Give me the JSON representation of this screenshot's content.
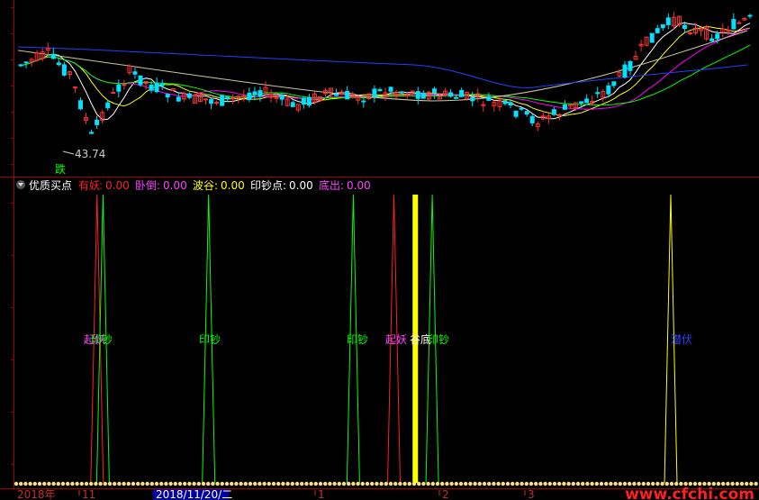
{
  "colors": {
    "background": "#000000",
    "border": "#a00000",
    "candle_up": "#ff3030",
    "candle_down": "#00e0ff",
    "ma5": "#ffffff",
    "ma10": "#ffff00",
    "ma20": "#ff00ff",
    "ma30": "#00ff00",
    "ma60": "#c8c8a0",
    "ma120": "#2040ff",
    "signal_red": "#ff2020",
    "signal_green": "#00ff00",
    "signal_yellow": "#ffff00",
    "signal_magenta": "#ff40ff",
    "signal_blue": "#3040ff",
    "url_red": "#ff2020"
  },
  "chart_data": [
    {
      "type": "candlestick",
      "panel": "price",
      "low_marker": {
        "value": "43.74",
        "label": "跌"
      },
      "series_shown": [
        "candles",
        "MA5",
        "MA10",
        "MA20",
        "MA30",
        "MA60",
        "MA120"
      ],
      "grid": false
    },
    {
      "type": "line",
      "panel": "indicator",
      "title": "优质买点",
      "legend": [
        {
          "name": "有妖",
          "value": "0.00",
          "color": "#ff2020"
        },
        {
          "name": "卧倒",
          "value": "0.00",
          "color": "#ff40ff"
        },
        {
          "name": "波谷",
          "value": "0.00",
          "color": "#ffff00"
        },
        {
          "name": "印钞点",
          "value": "0.00",
          "color": "#ffffff"
        },
        {
          "name": "底出",
          "value": "0.00",
          "color": "#ff40ff"
        }
      ],
      "signals": [
        {
          "kind": "spike",
          "color": "red",
          "bar": 0.112
        },
        {
          "kind": "spike",
          "color": "green",
          "bar": 0.12
        },
        {
          "kind": "spike",
          "color": "green",
          "bar": 0.263
        },
        {
          "kind": "spike",
          "color": "green",
          "bar": 0.459
        },
        {
          "kind": "spike",
          "color": "red",
          "bar": 0.514
        },
        {
          "kind": "bar",
          "color": "yellow",
          "bar": 0.543
        },
        {
          "kind": "spike",
          "color": "green",
          "bar": 0.566
        },
        {
          "kind": "spike",
          "color": "yellow",
          "bar": 0.889
        }
      ],
      "labels": [
        {
          "text": "起妖",
          "color": "magenta"
        },
        {
          "text": "印钞",
          "color": "green"
        },
        {
          "text": "印钞",
          "color": "green"
        },
        {
          "text": "印钞",
          "color": "green"
        },
        {
          "text": "起妖",
          "color": "magenta"
        },
        {
          "text": "谷底",
          "color": "white"
        },
        {
          "text": "印钞",
          "color": "green"
        },
        {
          "text": "潜伏",
          "color": "blue"
        }
      ]
    }
  ],
  "x_axis": {
    "labels": [
      {
        "text": "2018年",
        "highlight": false
      },
      {
        "text": "11",
        "highlight": false
      },
      {
        "text": "2018/11/20/二",
        "highlight": true
      },
      {
        "text": "1",
        "highlight": false
      },
      {
        "text": "2",
        "highlight": false
      },
      {
        "text": "3",
        "highlight": false
      }
    ]
  },
  "watermark": "www.cfchi.com"
}
